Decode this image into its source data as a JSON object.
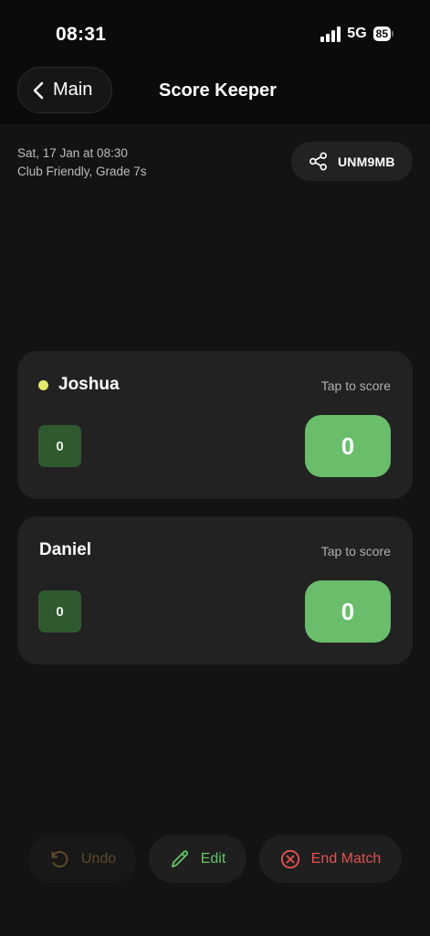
{
  "status_bar": {
    "time": "08:31",
    "network": "5G",
    "battery": "85"
  },
  "header": {
    "back_label": "Main",
    "title": "Score Keeper"
  },
  "match": {
    "datetime": "Sat, 17 Jan at 08:30",
    "details": "Club Friendly, Grade 7s",
    "share_code": "UNM9MB"
  },
  "players": [
    {
      "name": "Joshua",
      "tap_hint": "Tap to score",
      "small_score": "0",
      "score": "0",
      "serving": true
    },
    {
      "name": "Daniel",
      "tap_hint": "Tap to score",
      "small_score": "0",
      "score": "0",
      "serving": false
    }
  ],
  "actions": {
    "undo": "Undo",
    "edit": "Edit",
    "end_match": "End Match"
  },
  "colors": {
    "accent_green": "#69bd6b",
    "dark_green": "#2f5a30",
    "serve_dot": "#e3e86a",
    "danger_red": "#e35250",
    "disabled_brown": "#5e4a2a"
  },
  "icons": {
    "back": "chevron-left-icon",
    "share": "share-icon",
    "undo": "undo-icon",
    "edit": "pencil-icon",
    "end": "x-circle-icon"
  }
}
